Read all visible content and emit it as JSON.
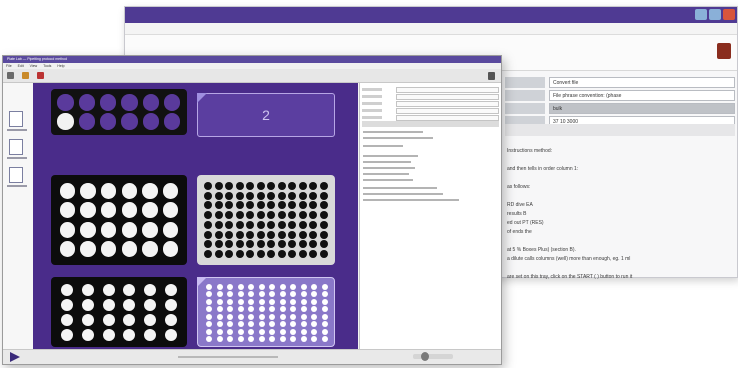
{
  "back_window": {
    "fields": [
      {
        "value": "Convert file"
      },
      {
        "value": "File phrase convention: (phase"
      },
      {
        "value": "bulk"
      },
      {
        "value": "37 10 3000"
      }
    ],
    "instructions": [
      "Instructions method:",
      "",
      "and then tells in order column 1:",
      "",
      "as follows:",
      "",
      "RD dive EA",
      "results B",
      "ed out PT (RES)",
      "of ends the",
      "",
      "at 5 % Boxes Plus) (section B).",
      "a dilute calls columns (well) more than enough, eg. 1 ml",
      "",
      "are set on this tray, click on the START ( ) button to run it"
    ]
  },
  "front_window": {
    "title": "Plate Lab — Pipetting protocol method",
    "menu": [
      "File",
      "Edit",
      "View",
      "Tools",
      "Help"
    ],
    "slot2_label": "2"
  },
  "icons": {
    "exit": "exit-door-icon",
    "play": "play-icon"
  },
  "colors": {
    "accent": "#4f3a93",
    "canvas": "#4a2c8a",
    "selected": "#8a78c9"
  }
}
